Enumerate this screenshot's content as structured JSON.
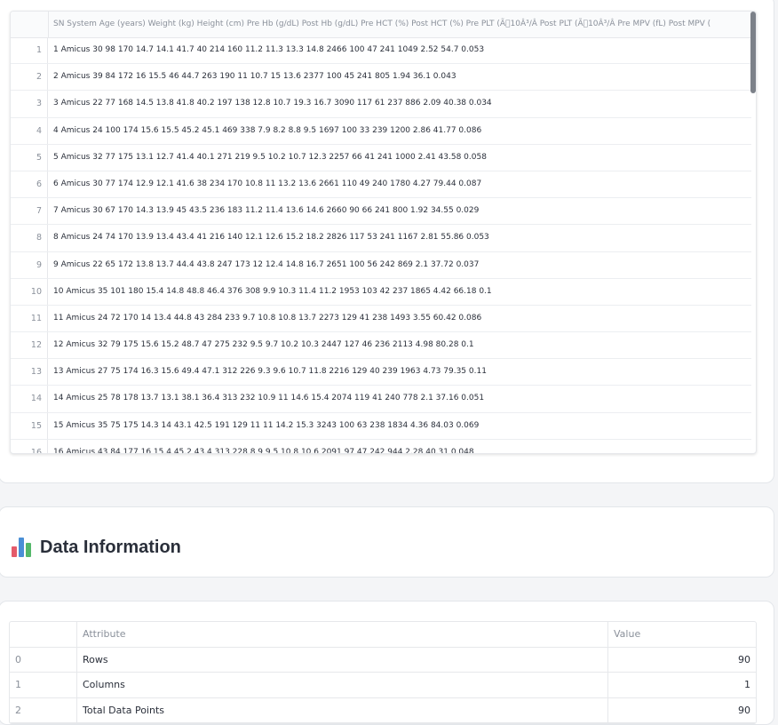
{
  "grid": {
    "header": "SN System Age (years) Weight (kg) Height (cm) Pre Hb (g/dL) Post Hb (g/dL) Pre HCT (%) Post HCT (%) Pre PLT (Ã\u000010Â³/Â Post PLT (Ã\u000010Â³/Â Pre MPV (fL) Post MPV (",
    "rows": [
      {
        "idx": "1",
        "text": "1 Amicus 30 98 170 14.7 14.1 41.7 40 214 160 11.2 11.3 13.3 14.8 2466 100 47 241 1049 2.52 54.7 0.053"
      },
      {
        "idx": "2",
        "text": "2 Amicus 39 84 172 16 15.5 46 44.7 263 190 11 10.7 15 13.6 2377 100 45 241 805 1.94 36.1 0.043"
      },
      {
        "idx": "3",
        "text": "3 Amicus 22 77 168 14.5 13.8 41.8 40.2 197 138 12.8 10.7 19.3 16.7 3090 117 61 237 886 2.09 40.38 0.034"
      },
      {
        "idx": "4",
        "text": "4 Amicus 24 100 174 15.6 15.5 45.2 45.1 469 338 7.9 8.2 8.8 9.5 1697 100 33 239 1200 2.86 41.77 0.086"
      },
      {
        "idx": "5",
        "text": "5 Amicus 32 77 175 13.1 12.7 41.4 40.1 271 219 9.5 10.2 10.7 12.3 2257 66 41 241 1000 2.41 43.58 0.058"
      },
      {
        "idx": "6",
        "text": "6 Amicus 30 77 174 12.9 12.1 41.6 38 234 170 10.8 11 13.2 13.6 2661 110 49 240 1780 4.27 79.44 0.087"
      },
      {
        "idx": "7",
        "text": "7 Amicus 30 67 170 14.3 13.9 45 43.5 236 183 11.2 11.4 13.6 14.6 2660 90 66 241 800 1.92 34.55 0.029"
      },
      {
        "idx": "8",
        "text": "8 Amicus 24 74 170 13.9 13.4 43.4 41 216 140 12.1 12.6 15.2 18.2 2826 117 53 241 1167 2.81 55.86 0.053"
      },
      {
        "idx": "9",
        "text": "9 Amicus 22 65 172 13.8 13.7 44.4 43.8 247 173 12 12.4 14.8 16.7 2651 100 56 242 869 2.1 37.72 0.037"
      },
      {
        "idx": "10",
        "text": "10 Amicus 35 101 180 15.4 14.8 48.8 46.4 376 308 9.9 10.3 11.4 11.2 1953 103 42 237 1865 4.42 66.18 0.1"
      },
      {
        "idx": "11",
        "text": "11 Amicus 24 72 170 14 13.4 44.8 43 284 233 9.7 10.8 10.8 13.7 2273 129 41 238 1493 3.55 60.42 0.086"
      },
      {
        "idx": "12",
        "text": "12 Amicus 32 79 175 15.6 15.2 48.7 47 275 232 9.5 9.7 10.2 10.3 2447 127 46 236 2113 4.98 80.28 0.1"
      },
      {
        "idx": "13",
        "text": "13 Amicus 27 75 174 16.3 15.6 49.4 47.1 312 226 9.3 9.6 10.7 11.8 2216 129 40 239 1963 4.73 79.35 0.11"
      },
      {
        "idx": "14",
        "text": "14 Amicus 25 78 178 13.7 13.1 38.1 36.4 313 232 10.9 11 14.6 15.4 2074 119 41 240 778 2.1 37.16 0.051"
      },
      {
        "idx": "15",
        "text": "15 Amicus 35 75 175 14.3 14 43.1 42.5 191 129 11 11 14.2 15.3 3243 100 63 238 1834 4.36 84.03 0.069"
      },
      {
        "idx": "16",
        "text": "16 Amicus 43 84 177 16 15.4 45.2 43.4 313 228 8.9 9.5 10.8 10.6 2091 97 47 242 944 2.28 40.31 0.048"
      }
    ]
  },
  "info": {
    "title": "Data Information"
  },
  "attributes": {
    "headers": [
      "",
      "Attribute",
      "Value"
    ],
    "rows": [
      {
        "idx": "0",
        "attr": "Rows",
        "value": "90"
      },
      {
        "idx": "1",
        "attr": "Columns",
        "value": "1"
      },
      {
        "idx": "2",
        "attr": "Total Data Points",
        "value": "90"
      }
    ]
  },
  "colors": {
    "icon_red": "#e45b6b",
    "icon_blue": "#4a8fd6",
    "icon_green": "#55b86a",
    "scroll_thumb": "#7c8189"
  },
  "icons": {
    "info_icon": "bar-chart-icon"
  }
}
